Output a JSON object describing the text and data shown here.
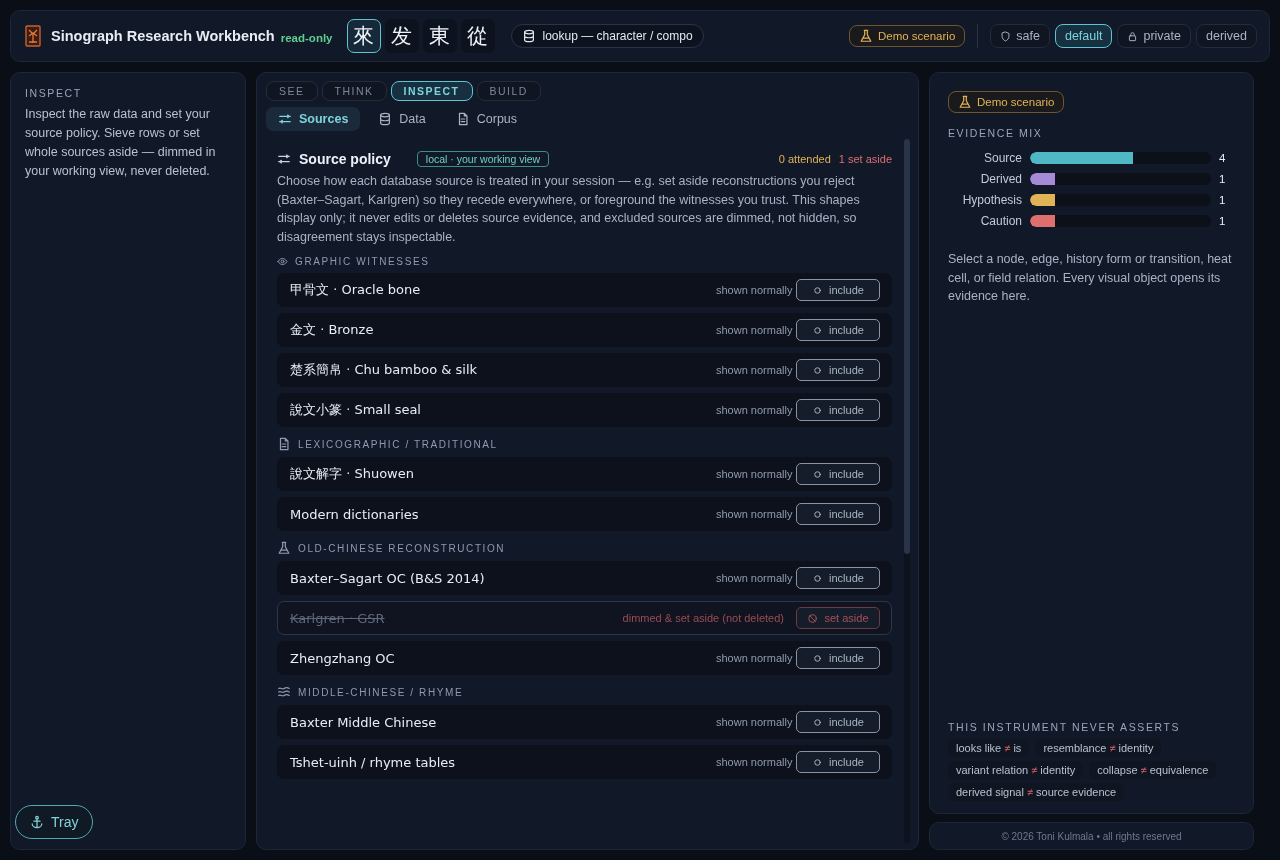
{
  "header": {
    "app_title": "Sinograph Research Workbench",
    "badge": "read-only",
    "characters": [
      {
        "char": "來",
        "selected": true
      },
      {
        "char": "发",
        "selected": false
      },
      {
        "char": "東",
        "selected": false
      },
      {
        "char": "從",
        "selected": false
      }
    ],
    "lookup": "lookup — character / compo",
    "demo": "Demo scenario",
    "modes": [
      {
        "label": "safe",
        "selected": false
      },
      {
        "label": "default",
        "selected": true
      },
      {
        "label": "private",
        "selected": false
      },
      {
        "label": "derived",
        "selected": false
      }
    ]
  },
  "left": {
    "heading": "INSPECT",
    "text": "Inspect the raw data and set your source policy. Sieve rows or set whole sources aside — dimmed in your working view, never deleted.",
    "tray": "Tray"
  },
  "center": {
    "tabs": [
      {
        "label": "SEE",
        "selected": false
      },
      {
        "label": "THINK",
        "selected": false
      },
      {
        "label": "INSPECT",
        "selected": true
      },
      {
        "label": "BUILD",
        "selected": false
      }
    ],
    "subtabs": [
      {
        "label": "Sources",
        "selected": true
      },
      {
        "label": "Data",
        "selected": false
      },
      {
        "label": "Corpus",
        "selected": false
      }
    ],
    "policy": {
      "title": "Source policy",
      "scope": "local · your working view",
      "attended": "0 attended",
      "set_aside": "1 set aside",
      "description": "Choose how each database source is treated in your session — e.g. set aside reconstructions you reject (Baxter–Sagart, Karlgren) so they recede everywhere, or foreground the witnesses you trust. This shapes display only; it never edits or deletes source evidence, and excluded sources are dimmed, not hidden, so disagreement stays inspectable."
    },
    "groups": [
      {
        "title": "GRAPHIC WITNESSES",
        "sources": [
          {
            "name": "甲骨文 · Oracle bone",
            "status": "shown normally",
            "action": "include",
            "set_aside": false
          },
          {
            "name": "金文 · Bronze",
            "status": "shown normally",
            "action": "include",
            "set_aside": false
          },
          {
            "name": "楚系簡帛 · Chu bamboo & silk",
            "status": "shown normally",
            "action": "include",
            "set_aside": false
          },
          {
            "name": "說文小篆 · Small seal",
            "status": "shown normally",
            "action": "include",
            "set_aside": false
          }
        ]
      },
      {
        "title": "LEXICOGRAPHIC / TRADITIONAL",
        "sources": [
          {
            "name": "說文解字 · Shuowen",
            "status": "shown normally",
            "action": "include",
            "set_aside": false
          },
          {
            "name": "Modern dictionaries",
            "status": "shown normally",
            "action": "include",
            "set_aside": false
          }
        ]
      },
      {
        "title": "OLD-CHINESE RECONSTRUCTION",
        "sources": [
          {
            "name": "Baxter–Sagart OC (B&S 2014)",
            "status": "shown normally",
            "action": "include",
            "set_aside": false
          },
          {
            "name": "Karlgren · GSR",
            "status": "dimmed & set aside (not deleted)",
            "action": "set aside",
            "set_aside": true
          },
          {
            "name": "Zhengzhang OC",
            "status": "shown normally",
            "action": "include",
            "set_aside": false
          }
        ]
      },
      {
        "title": "MIDDLE-CHINESE / RHYME",
        "sources": [
          {
            "name": "Baxter Middle Chinese",
            "status": "shown normally",
            "action": "include",
            "set_aside": false
          },
          {
            "name": "Tshet-uinh / rhyme tables",
            "status": "shown normally",
            "action": "include",
            "set_aside": false
          }
        ]
      }
    ]
  },
  "right": {
    "demo": "Demo scenario",
    "mix_heading": "EVIDENCE MIX",
    "mix": [
      {
        "label": "Source",
        "count": "4",
        "level": 0.57,
        "color": "#4fb8c4"
      },
      {
        "label": "Derived",
        "count": "1",
        "level": 0.14,
        "color": "#a58bd6"
      },
      {
        "label": "Hypothesis",
        "count": "1",
        "level": 0.14,
        "color": "#e0b357"
      },
      {
        "label": "Caution",
        "count": "1",
        "level": 0.14,
        "color": "#dd6f6f"
      }
    ],
    "hint": "Select a node, edge, history form or transition, heat cell, or field relation. Every visual object opens its evidence here.",
    "asserts_heading": "THIS INSTRUMENT NEVER ASSERTS",
    "asserts": [
      {
        "left": "looks like",
        "sign": "≠",
        "right": "is"
      },
      {
        "left": "resemblance",
        "sign": "≠",
        "right": "identity"
      },
      {
        "left": "variant relation",
        "sign": "≠",
        "right": "identity"
      },
      {
        "left": "collapse",
        "sign": "≠",
        "right": "equivalence"
      },
      {
        "left": "derived signal",
        "sign": "≠",
        "right": "source evidence"
      }
    ],
    "footer": "© 2026 Toni Kulmala  •  all rights reserved"
  }
}
